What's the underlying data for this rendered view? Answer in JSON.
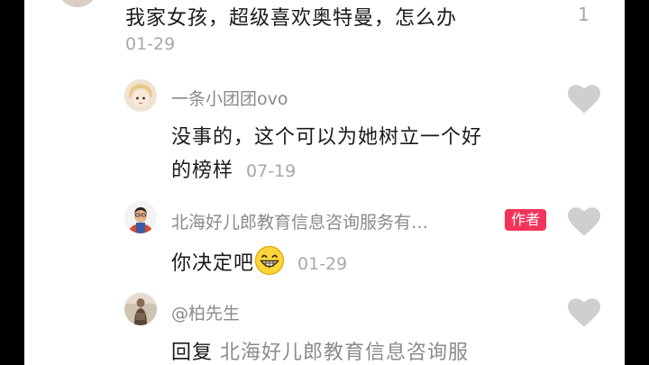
{
  "top_comment": {
    "text": "我家女孩，超级喜欢奥特曼，怎么办",
    "time": "01-29",
    "like_count": "1"
  },
  "replies": [
    {
      "username": "一条小团团ovo",
      "text_line1": "没事的，这个可以为她树立一个好",
      "text_line2": "的榜样",
      "time": "07-19",
      "avatar_icon": "anime-girl-avatar"
    },
    {
      "username": "北海好儿郎教育信息咨询服务有…",
      "badge": "作者",
      "text": "你决定吧",
      "emoji_icon": "grin-emoji",
      "time": "01-29",
      "avatar_icon": "man-portrait-avatar"
    },
    {
      "username": "@柏先生",
      "reply_prefix": "回复",
      "reply_target": "北海好儿郎教育信息咨询服",
      "avatar_icon": "portrait-photo-avatar"
    }
  ],
  "colors": {
    "badge": "#f2345a",
    "heart": "#cfcfcf",
    "muted_text": "#8a8a8a",
    "frame": "#000000"
  }
}
